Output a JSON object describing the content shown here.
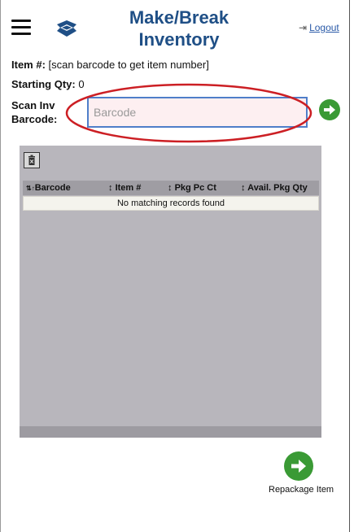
{
  "header": {
    "title": "Make/Break Inventory",
    "logout_label": "Logout"
  },
  "item": {
    "label": "Item #:",
    "value": "[scan barcode to get item number]"
  },
  "starting_qty": {
    "label": "Starting Qty:",
    "value": "0"
  },
  "scan": {
    "label": "Scan Inv Barcode:",
    "placeholder": "Barcode"
  },
  "table": {
    "columns": [
      "Barcode",
      "Item #",
      "Pkg Pc Ct",
      "Avail. Pkg Qty"
    ],
    "empty_message": "No matching records found"
  },
  "actions": {
    "repackage_label": "Repackage Item"
  },
  "colors": {
    "title": "#1f4f86",
    "accent_green": "#3a9a35",
    "highlight_red": "#cc1f24",
    "panel_gray": "#b8b6bc"
  }
}
